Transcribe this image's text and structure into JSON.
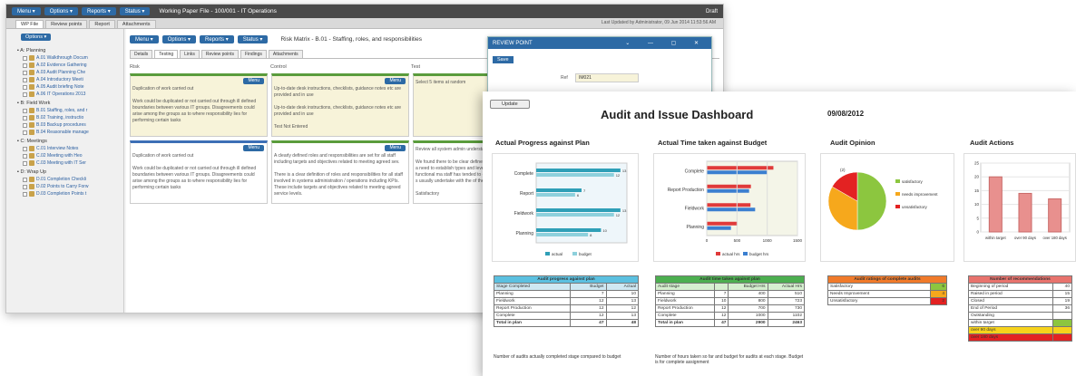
{
  "back": {
    "menu": [
      "Menu ▾",
      "Options ▾",
      "Reports ▾",
      "Status ▾"
    ],
    "title": "Working Paper File - 100/001 - IT Operations",
    "status": "Draft",
    "tabs": [
      "WP File",
      "Review points",
      "Report",
      "Attachments"
    ],
    "last_updated": "Last Updated by Administrator, 09 Jun 2014 11:53:56 AM",
    "options": "Options ▾",
    "sections": [
      {
        "label": "A: Planning",
        "items": [
          {
            "code": "A.01",
            "label": "Walkthrough Docum"
          },
          {
            "code": "A.02",
            "label": "Evidence Gathering"
          },
          {
            "code": "A.03",
            "label": "Audit Planning Che"
          },
          {
            "code": "A.04",
            "label": "Introductory Meeti"
          },
          {
            "code": "A.05",
            "label": "Audit briefing Note"
          },
          {
            "code": "A.06",
            "label": "IT Operations 2013"
          }
        ]
      },
      {
        "label": "B: Field Work",
        "items": [
          {
            "code": "B.01",
            "label": "Staffing, roles, and r"
          },
          {
            "code": "B.02",
            "label": "Training, instructio"
          },
          {
            "code": "B.03",
            "label": "Backup procedures"
          },
          {
            "code": "B.04",
            "label": "Reasonable manage"
          }
        ]
      },
      {
        "label": "C: Meetings",
        "items": [
          {
            "code": "C.01",
            "label": "Interview Notes"
          },
          {
            "code": "C.02",
            "label": "Meeting with Heo"
          },
          {
            "code": "C.03",
            "label": "Meeting with IT Ser"
          }
        ]
      },
      {
        "label": "D: Wrap Up",
        "items": [
          {
            "code": "D.01",
            "label": "Completion Checkli"
          },
          {
            "code": "D.02",
            "label": "Points to Carry Forw"
          },
          {
            "code": "D.03",
            "label": "Completion Points t"
          }
        ]
      }
    ],
    "wp_title": "Risk Matrix - B.01 - Staffing, roles, and responsibilities",
    "subtabs": [
      "Details",
      "Testing",
      "Links",
      "Review points",
      "Findings",
      "Attachments"
    ],
    "columns": [
      "Risk",
      "Control",
      "Test"
    ],
    "menu_btn": "Menu",
    "cards": [
      [
        "Duplication of work carried out\n\nWork could be duplicated or not carried out through ill defined boundaries between various IT groups. Disagreements could arise among the groups as to where responsibility lies for performing certain tasks",
        "Duplication of work carried out\n\nWork could be duplicated or not carried out through ill defined boundaries between various IT groups. Disagreements could arise among the groups as to where responsibility lies for performing certain tasks"
      ],
      [
        "Up-to-date desk instructions, checklists, guidance notes etc are provided and in use\n\nUp-to-date desk instructions, checklists, guidance notes etc are provided and in use\n\nTest Not Entered",
        "A clearly defined roles and responsibilities are set for all staff including targets and objectives related to meeting agreed sev.\n\nThere is a clear definition of roles and responsibilities for all staff involved in systems administration / operations including KPIs. These include targets and objectives related to meeting agreed service levels.\n\nPartially Effective"
      ],
      [
        "Select 5 items at random",
        "Review all system admin understanding. Check the l\n\nWe found there to be clear defined responsibilities for a particular a need to establish types and levels of service Historically, functional ma staff has tended to evolve Facilities Management or s usually undertake with the of the team.\n\nSatisfactory\n\nTested: Verified to"
      ]
    ],
    "review_point": {
      "title": "REVIEW POINT",
      "controls": "⌄ — ▢ ✕",
      "save": "Save",
      "ref_label": "Ref",
      "ref_value": "IM021"
    }
  },
  "dashboard": {
    "update": "Update",
    "title": "Audit and Issue Dashboard",
    "date": "09/08/2012",
    "section_titles": [
      "Actual Progress against Plan",
      "Actual Time taken against Budget",
      "Audit Opinion",
      "Audit Actions"
    ],
    "tables": {
      "progress": {
        "title": "Audit progress against plan",
        "headers": [
          "Stage Completed",
          "Budget",
          "Actual"
        ],
        "rows": [
          [
            "Planning",
            "7",
            "10"
          ],
          [
            "Fieldwork",
            "12",
            "13"
          ],
          [
            "Report Production",
            "12",
            "12"
          ],
          [
            "Complete",
            "12",
            "13"
          ]
        ],
        "total": [
          "Total in plan",
          "47",
          "48"
        ],
        "note": "Number of audits actually completed stage compared to budget"
      },
      "time": {
        "title": "Audit time taken against plan",
        "headers": [
          "Audit stage",
          "",
          "Budget Hrs",
          "Actual Hrs"
        ],
        "rows": [
          [
            "Planning",
            "7",
            "400",
            "510"
          ],
          [
            "Fieldwork",
            "10",
            "800",
            "723"
          ],
          [
            "Report Production",
            "12",
            "700",
            "730"
          ],
          [
            "Complete",
            "12",
            "1000",
            "1102"
          ]
        ],
        "total": [
          "Total in plan",
          "47",
          "2900",
          "2463"
        ],
        "note": "Number of hours taken so far and budget for audits at each stage. Budget is for complete assignment"
      },
      "opinion": {
        "title": "Audit ratings of complete audits",
        "rows": [
          [
            "Satisfactory",
            "6"
          ],
          [
            "Needs Improvement",
            "4"
          ],
          [
            "Unsatisfactory",
            "2"
          ]
        ]
      },
      "actions": {
        "title": "Number of recommendations",
        "rows": [
          [
            "Beginning of period",
            "40"
          ],
          [
            "Raised in period",
            "15"
          ],
          [
            "Closed",
            "19"
          ],
          [
            "End of Period",
            "36"
          ],
          [
            "Outstanding",
            ""
          ],
          [
            "within target",
            ""
          ],
          [
            "over 90 days",
            ""
          ],
          [
            "over 180 days",
            ""
          ]
        ]
      }
    },
    "legend": {
      "actual": "actual",
      "budget": "budget",
      "actual_hrs": "actual hrs",
      "budget_hrs": "budget hrs"
    },
    "opinion_legend": [
      "satisfactory",
      "needs improvement",
      "unsatisfactory"
    ]
  },
  "chart_data": [
    {
      "type": "bar",
      "title": "Actual Progress against Plan",
      "orientation": "horizontal",
      "categories": [
        "Complete",
        "Report",
        "Fieldwork",
        "Planning"
      ],
      "series": [
        {
          "name": "actual",
          "values": [
            13,
            7,
            13,
            10
          ],
          "color": "#2f9fb7"
        },
        {
          "name": "budget",
          "values": [
            12,
            6,
            12,
            8
          ],
          "color": "#8dd0dc"
        }
      ]
    },
    {
      "type": "bar",
      "title": "Actual Time taken against Budget",
      "orientation": "horizontal",
      "categories": [
        "Complete",
        "Report Production",
        "Fieldwork",
        "Planning"
      ],
      "series": [
        {
          "name": "actual hrs",
          "values": [
            1102,
            730,
            723,
            510
          ],
          "color": "#e03a3a"
        },
        {
          "name": "budget hrs",
          "values": [
            1000,
            700,
            800,
            400
          ],
          "color": "#3b7fd0"
        }
      ],
      "xticks": [
        "0",
        "500",
        "1000",
        "1500"
      ],
      "xlim": [
        0,
        1500
      ]
    },
    {
      "type": "pie",
      "title": "Audit Opinion",
      "labels": [
        "satisfactory",
        "needs improvement",
        "unsatisfactory"
      ],
      "values": [
        6,
        4,
        2
      ],
      "colors": [
        "#8cc63f",
        "#f6a81c",
        "#e32222"
      ],
      "data_labels": [
        "",
        "",
        "(2)"
      ]
    },
    {
      "type": "bar",
      "title": "Audit Actions",
      "categories": [
        "within target",
        "over 90 days",
        "over 180 days"
      ],
      "values": [
        20,
        14,
        12
      ],
      "ylim": [
        0,
        25
      ],
      "color": "#e8908e",
      "yticks": [
        "0",
        "5",
        "10",
        "15",
        "20",
        "25"
      ]
    }
  ]
}
